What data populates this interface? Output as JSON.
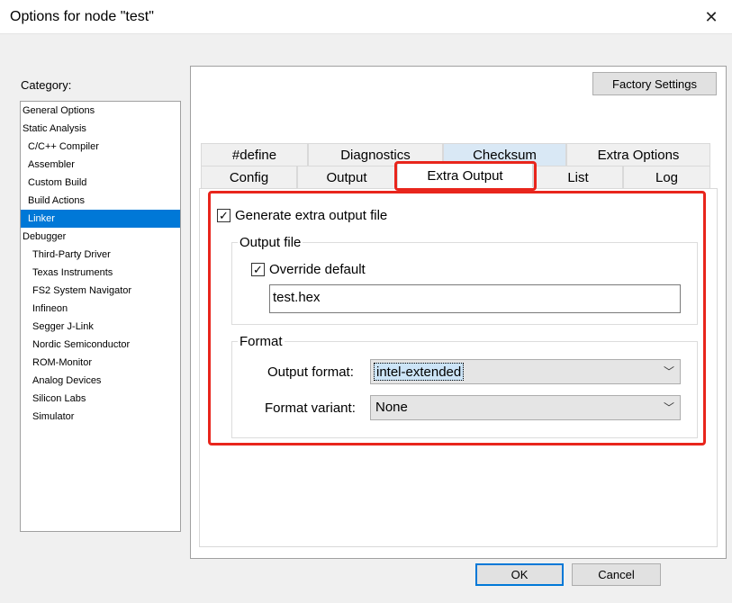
{
  "window": {
    "title": "Options for node \"test\"",
    "close_glyph": "✕"
  },
  "category": {
    "label": "Category:",
    "items": [
      {
        "label": "General Options"
      },
      {
        "label": "Static Analysis"
      },
      {
        "label": "C/C++ Compiler"
      },
      {
        "label": "Assembler"
      },
      {
        "label": "Custom Build"
      },
      {
        "label": "Build Actions"
      },
      {
        "label": "Linker"
      },
      {
        "label": "Debugger"
      },
      {
        "label": "Third-Party Driver"
      },
      {
        "label": "Texas Instruments"
      },
      {
        "label": "FS2 System Navigator"
      },
      {
        "label": "Infineon"
      },
      {
        "label": "Segger J-Link"
      },
      {
        "label": "Nordic Semiconductor"
      },
      {
        "label": "ROM-Monitor"
      },
      {
        "label": "Analog Devices"
      },
      {
        "label": "Silicon Labs"
      },
      {
        "label": "Simulator"
      }
    ],
    "selected": "Linker"
  },
  "factory_settings_label": "Factory Settings",
  "tabs": {
    "row1": [
      "#define",
      "Diagnostics",
      "Checksum",
      "Extra Options"
    ],
    "row2": [
      "Config",
      "Output",
      "Extra Output",
      "List",
      "Log"
    ],
    "active": "Extra Output"
  },
  "extra_output": {
    "generate_label": "Generate extra output file",
    "generate_checked": true,
    "output_file_group": "Output file",
    "override_label": "Override default",
    "override_checked": true,
    "filename": "test.hex",
    "format_group": "Format",
    "output_format_label": "Output format:",
    "output_format_value": "intel-extended",
    "format_variant_label": "Format variant:",
    "format_variant_value": "None"
  },
  "buttons": {
    "ok": "OK",
    "cancel": "Cancel"
  },
  "annotation_color": "#e8251c"
}
